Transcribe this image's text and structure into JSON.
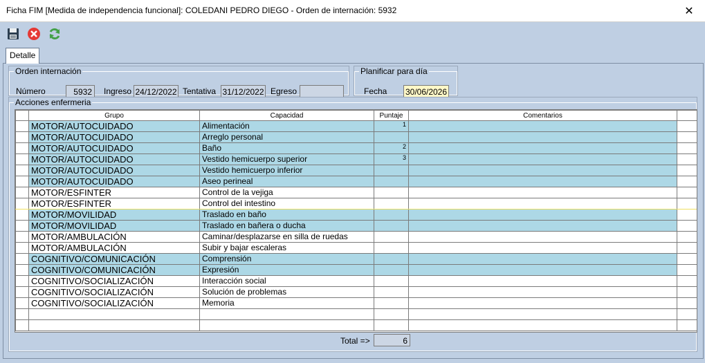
{
  "window": {
    "title": "Ficha FIM [Medida de independencia funcional]: COLEDANI PEDRO DIEGO - Orden de internación: 5932",
    "close_glyph": "✕"
  },
  "toolbar": {
    "save_icon": "save-icon",
    "cancel_icon": "cancel-icon",
    "refresh_icon": "refresh-icon"
  },
  "tab": {
    "label": "Detalle"
  },
  "orden": {
    "legend": "Orden internación",
    "numero_label": "Número",
    "numero_value": "5932",
    "ingreso_label": "Ingreso",
    "ingreso_value": "24/12/2022",
    "tentativa_label": "Tentativa",
    "tentativa_value": "31/12/2022",
    "egreso_label": "Egreso",
    "egreso_value": ""
  },
  "planificar": {
    "legend": "Planificar para día",
    "fecha_label": "Fecha",
    "fecha_value": "30/06/2026"
  },
  "acciones": {
    "legend": "Acciones enfermeria",
    "headers": {
      "grupo": "Grupo",
      "capacidad": "Capacidad",
      "puntaje": "Puntaje",
      "comentarios": "Comentarios"
    },
    "rows": [
      {
        "grupo": "MOTOR/AUTOCUIDADO",
        "capacidad": "Alimentación",
        "puntaje": "1",
        "comentarios": ""
      },
      {
        "grupo": "MOTOR/AUTOCUIDADO",
        "capacidad": "Arreglo personal",
        "puntaje": "",
        "comentarios": ""
      },
      {
        "grupo": "MOTOR/AUTOCUIDADO",
        "capacidad": "Baño",
        "puntaje": "2",
        "comentarios": ""
      },
      {
        "grupo": "MOTOR/AUTOCUIDADO",
        "capacidad": "Vestido hemicuerpo superior",
        "puntaje": "3",
        "comentarios": ""
      },
      {
        "grupo": "MOTOR/AUTOCUIDADO",
        "capacidad": "Vestido hemicuerpo inferior",
        "puntaje": "",
        "comentarios": ""
      },
      {
        "grupo": "MOTOR/AUTOCUIDADO",
        "capacidad": "Aseo perineal",
        "puntaje": "",
        "comentarios": ""
      },
      {
        "grupo": "MOTOR/ESFINTER",
        "capacidad": "Control de la vejiga",
        "puntaje": "",
        "comentarios": ""
      },
      {
        "grupo": "MOTOR/ESFINTER",
        "capacidad": "Control del intestino",
        "puntaje": "",
        "comentarios": ""
      },
      {
        "grupo": "MOTOR/MOVILIDAD",
        "capacidad": "Traslado en baño",
        "puntaje": "",
        "comentarios": ""
      },
      {
        "grupo": "MOTOR/MOVILIDAD",
        "capacidad": "Traslado en bañera o ducha",
        "puntaje": "",
        "comentarios": ""
      },
      {
        "grupo": "MOTOR/AMBULACIÓN",
        "capacidad": "Caminar/desplazarse en silla de ruedas",
        "puntaje": "",
        "comentarios": ""
      },
      {
        "grupo": "MOTOR/AMBULACIÓN",
        "capacidad": "Subir y bajar escaleras",
        "puntaje": "",
        "comentarios": ""
      },
      {
        "grupo": "COGNITIVO/COMUNICACIÓN",
        "capacidad": "Comprensión",
        "puntaje": "",
        "comentarios": ""
      },
      {
        "grupo": "COGNITIVO/COMUNICACIÓN",
        "capacidad": "Expresión",
        "puntaje": "",
        "comentarios": ""
      },
      {
        "grupo": "COGNITIVO/SOCIALIZACIÓN",
        "capacidad": "Interacción social",
        "puntaje": "",
        "comentarios": ""
      },
      {
        "grupo": "COGNITIVO/SOCIALIZACIÓN",
        "capacidad": "Solución de problemas",
        "puntaje": "",
        "comentarios": ""
      },
      {
        "grupo": "COGNITIVO/SOCIALIZACIÓN",
        "capacidad": "Memoria",
        "puntaje": "",
        "comentarios": ""
      }
    ],
    "total_label": "Total =>",
    "total_value": "6"
  },
  "colors": {
    "panel_bg": "#bfcfe3",
    "row_teal": "#add8e6",
    "date_bg": "#fff8c8"
  }
}
